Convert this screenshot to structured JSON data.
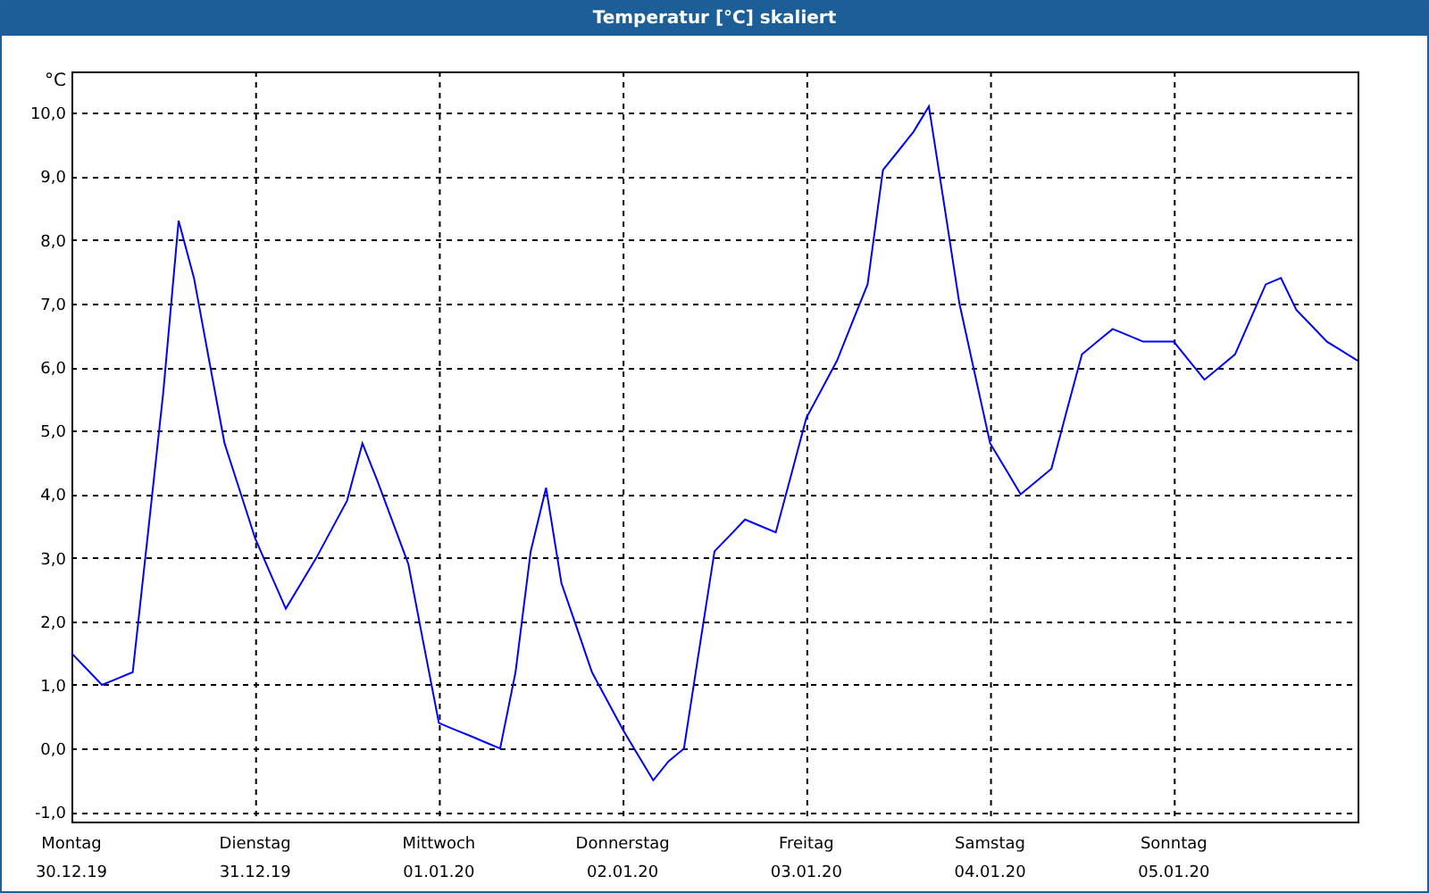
{
  "window": {
    "title": "Temperatur [°C] skaliert"
  },
  "chart": {
    "dates": [
      "30.12.19",
      "31.12.19",
      "01.01.20",
      "02.01.20",
      "03.01.20",
      "04.01.20",
      "05.01.20"
    ],
    "chart_data": {
      "type": "line",
      "grid": true,
      "ylabel": "°C",
      "ylim": [
        -1.15,
        10.65
      ],
      "categories": [
        "Montag",
        null,
        null,
        null,
        null,
        null,
        null,
        null,
        null,
        null,
        null,
        null,
        "Dienstag",
        null,
        null,
        null,
        null,
        null,
        null,
        null,
        null,
        null,
        null,
        null,
        "Mittwoch",
        null,
        null,
        null,
        null,
        null,
        null,
        null,
        null,
        null,
        null,
        null,
        "Donnerstag",
        null,
        null,
        null,
        null,
        null,
        null,
        null,
        null,
        null,
        null,
        null,
        "Freitag",
        null,
        null,
        null,
        null,
        null,
        null,
        null,
        null,
        null,
        null,
        null,
        "Samstag",
        null,
        null,
        null,
        null,
        null,
        null,
        null,
        null,
        null,
        null,
        null,
        "Sonntag",
        null,
        null,
        null,
        null,
        null,
        null,
        null,
        null,
        null,
        null,
        null,
        null
      ],
      "yticks": [
        {
          "value": -1,
          "label": "-1,0"
        },
        {
          "value": 0,
          "label": "0,0"
        },
        {
          "value": 1,
          "label": "1,0"
        },
        {
          "value": 2,
          "label": "2,0"
        },
        {
          "value": 3,
          "label": "3,0"
        },
        {
          "value": 4,
          "label": "4,0"
        },
        {
          "value": 5,
          "label": "5,0"
        },
        {
          "value": 6,
          "label": "6,0"
        },
        {
          "value": 7,
          "label": "7,0"
        },
        {
          "value": 8,
          "label": "8,0"
        },
        {
          "value": 9,
          "label": "9,0"
        },
        {
          "value": 10,
          "label": "10,0"
        }
      ],
      "series": [
        {
          "color": "#0000ff",
          "values": [
            1.5,
            1.25,
            1.0,
            1.1,
            1.2,
            3.4,
            5.6,
            8.3,
            7.4,
            6.1,
            4.8,
            4.05,
            3.3,
            2.75,
            2.2,
            2.6,
            3.0,
            3.45,
            3.9,
            4.8,
            4.2,
            3.55,
            2.9,
            1.65,
            0.4,
            0.3,
            0.2,
            0.1,
            0.0,
            1.2,
            3.1,
            4.1,
            2.6,
            1.9,
            1.2,
            0.75,
            0.3,
            -0.1,
            -0.5,
            -0.2,
            0.0,
            1.55,
            3.1,
            3.35,
            3.6,
            3.5,
            3.4,
            4.3,
            5.2,
            5.65,
            6.1,
            6.7,
            7.3,
            9.1,
            9.4,
            9.7,
            10.1,
            8.55,
            7.0,
            5.9,
            4.8,
            4.4,
            4.0,
            4.2,
            4.4,
            5.3,
            6.2,
            6.4,
            6.6,
            6.5,
            6.4,
            6.4,
            6.4,
            6.1,
            5.8,
            6.0,
            6.2,
            6.75,
            7.3,
            7.4,
            6.9,
            6.65,
            6.4,
            6.25,
            6.1
          ]
        }
      ]
    }
  }
}
